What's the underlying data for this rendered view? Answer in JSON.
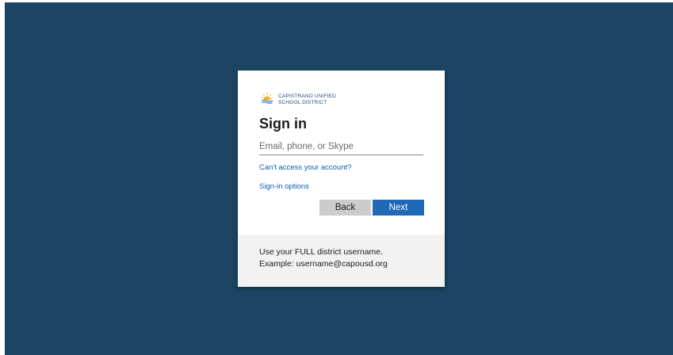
{
  "colors": {
    "backdrop": "#1b4563",
    "card": "#ffffff",
    "brand_text": "#1f4f85",
    "link": "#0b5cad",
    "next_button": "#1f69b7",
    "back_button": "#cccccc",
    "hint_panel": "#f2f2f2"
  },
  "logo": {
    "icon": "sun-waves-logo-icon",
    "line1": "CAPISTRANO UNIFIED",
    "line2": "SCHOOL DISTRICT"
  },
  "signin": {
    "title": "Sign in",
    "email_placeholder": "Email, phone, or Skype",
    "email_value": "",
    "cant_access_link": "Can't access your account?",
    "options_link": "Sign-in options",
    "back_label": "Back",
    "next_label": "Next"
  },
  "hint": {
    "line1": "Use your FULL district username.",
    "line2": "Example: username@capousd.org"
  }
}
